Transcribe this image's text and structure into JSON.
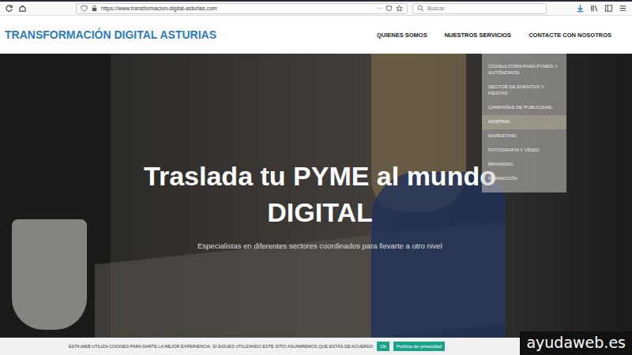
{
  "browser": {
    "url": "https://www.transformacion-digital-asturias.com",
    "menu": "···",
    "search_placeholder": "Buscar"
  },
  "header": {
    "logo": "TRANSFORMACIÓN DIGITAL ASTURIAS",
    "nav": [
      {
        "label": "QUIENES SOMOS",
        "selected": false
      },
      {
        "label": "NUESTROS SERVICIOS",
        "selected": true
      },
      {
        "label": "CONTACTE CON NOSOTROS",
        "selected": false
      }
    ]
  },
  "dropdown": [
    {
      "label": "CONSULTORÍA PARA PYMES Y AUTÓNOMOS",
      "selected": false
    },
    {
      "label": "SECTOR DE EVENTOS Y FIESTAS",
      "selected": false
    },
    {
      "label": "CAMPAÑAS DE PUBLICIDAD",
      "selected": false
    },
    {
      "label": "HOSTING",
      "selected": true
    },
    {
      "label": "MARKETING",
      "selected": false
    },
    {
      "label": "FOTOGRAFÍA Y VÍDEO",
      "selected": false
    },
    {
      "label": "BRANDING",
      "selected": false
    },
    {
      "label": "FORMACIÓN",
      "selected": false
    }
  ],
  "hero": {
    "title": "Traslada tu PYME al mundo DIGITAL",
    "subtitle": "Especialistas en diferentes sectores coordinados para llevarte a otro nivel"
  },
  "cookie_bar": {
    "text": "ESTA WEB UTILIZA COOKIES PARA DARTE LA MEJOR EXPERIENCIA. SI SIGUES UTILIZANDO ESTE SITIO ASUMIREMOS QUE ESTÁS DE ACUERDO",
    "buttons": [
      "Ok",
      "Política de privacidad"
    ]
  },
  "watermark": "ayudaweb.es"
}
